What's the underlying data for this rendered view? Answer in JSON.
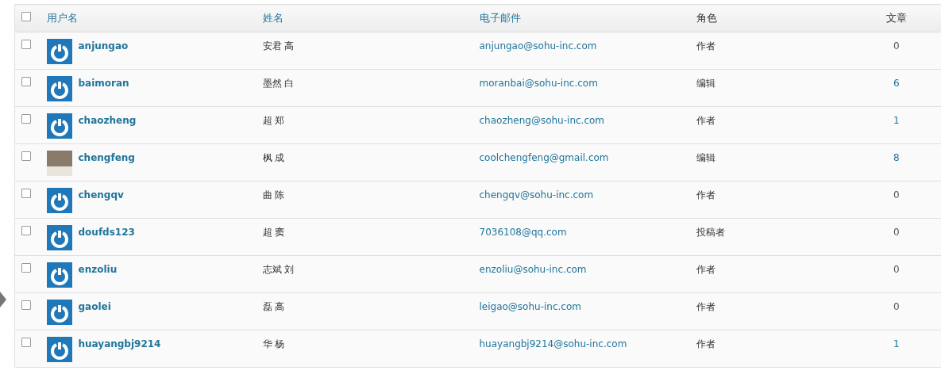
{
  "table": {
    "columns": [
      {
        "label": "用户名",
        "sortable": true
      },
      {
        "label": "姓名",
        "sortable": true
      },
      {
        "label": "电子邮件",
        "sortable": true
      },
      {
        "label": "角色",
        "sortable": false
      },
      {
        "label": "文章",
        "sortable": false
      }
    ],
    "select_all": {
      "checked": false
    },
    "rows": [
      {
        "checked": false,
        "kind": "default",
        "username": "anjungao",
        "name": "安君 高",
        "email": "anjungao@sohu-inc.com",
        "role": "作者",
        "posts": "0",
        "posts_linked": false
      },
      {
        "checked": false,
        "kind": "default",
        "username": "baimoran",
        "name": "墨然 白",
        "email": "moranbai@sohu-inc.com",
        "role": "编辑",
        "posts": "6",
        "posts_linked": true
      },
      {
        "checked": false,
        "kind": "default",
        "username": "chaozheng",
        "name": "超 郑",
        "email": "chaozheng@sohu-inc.com",
        "role": "作者",
        "posts": "1",
        "posts_linked": true
      },
      {
        "checked": false,
        "kind": "photo",
        "username": "chengfeng",
        "name": "枫 成",
        "email": "coolchengfeng@gmail.com",
        "role": "编辑",
        "posts": "8",
        "posts_linked": true
      },
      {
        "checked": false,
        "kind": "default",
        "username": "chengqv",
        "name": "曲 陈",
        "email": "chengqv@sohu-inc.com",
        "role": "作者",
        "posts": "0",
        "posts_linked": false
      },
      {
        "checked": false,
        "kind": "default",
        "username": "doufds123",
        "name": "超 窦",
        "email": "7036108@qq.com",
        "role": "投稿者",
        "posts": "0",
        "posts_linked": false
      },
      {
        "checked": false,
        "kind": "default",
        "username": "enzoliu",
        "name": "志斌 刘",
        "email": "enzoliu@sohu-inc.com",
        "role": "作者",
        "posts": "0",
        "posts_linked": false
      },
      {
        "checked": false,
        "kind": "default",
        "username": "gaolei",
        "name": "磊 高",
        "email": "leigao@sohu-inc.com",
        "role": "作者",
        "posts": "0",
        "posts_linked": false
      },
      {
        "checked": false,
        "kind": "default",
        "username": "huayangbj9214",
        "name": "华 杨",
        "email": "huayangbj9214@sohu-inc.com",
        "role": "作者",
        "posts": "1",
        "posts_linked": true
      }
    ]
  }
}
